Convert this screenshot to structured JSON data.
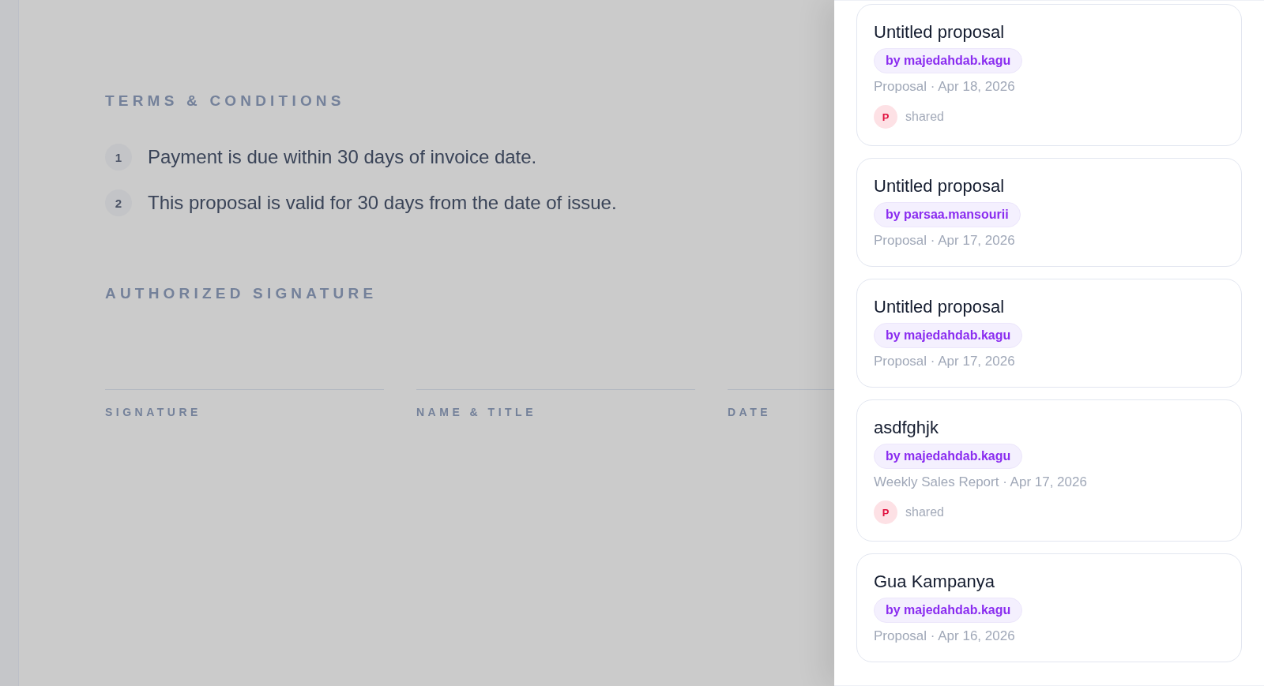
{
  "document": {
    "terms": {
      "heading": "TERMS & CONDITIONS",
      "items": [
        {
          "number": "1",
          "text": "Payment is due within 30 days of invoice date."
        },
        {
          "number": "2",
          "text": "This proposal is valid for 30 days from the date of issue."
        }
      ]
    },
    "signature": {
      "heading": "AUTHORIZED SIGNATURE",
      "fields": [
        {
          "label": "SIGNATURE"
        },
        {
          "label": "NAME & TITLE"
        },
        {
          "label": "DATE"
        }
      ]
    }
  },
  "proposals_panel": {
    "cards": [
      {
        "title": "Untitled proposal",
        "author": "by majedahdab.kagu",
        "meta": "Proposal · Apr 18, 2026",
        "shared": {
          "initial": "P",
          "label": "shared"
        }
      },
      {
        "title": "Untitled proposal",
        "author": "by parsaa.mansourii",
        "meta": "Proposal · Apr 17, 2026"
      },
      {
        "title": "Untitled proposal",
        "author": "by majedahdab.kagu",
        "meta": "Proposal · Apr 17, 2026"
      },
      {
        "title": "asdfghjk",
        "author": "by majedahdab.kagu",
        "meta": "Weekly Sales Report · Apr 17, 2026",
        "shared": {
          "initial": "P",
          "label": "shared"
        }
      },
      {
        "title": "Gua Kampanya",
        "author": "by majedahdab.kagu",
        "meta": "Proposal · Apr 16, 2026"
      }
    ]
  }
}
